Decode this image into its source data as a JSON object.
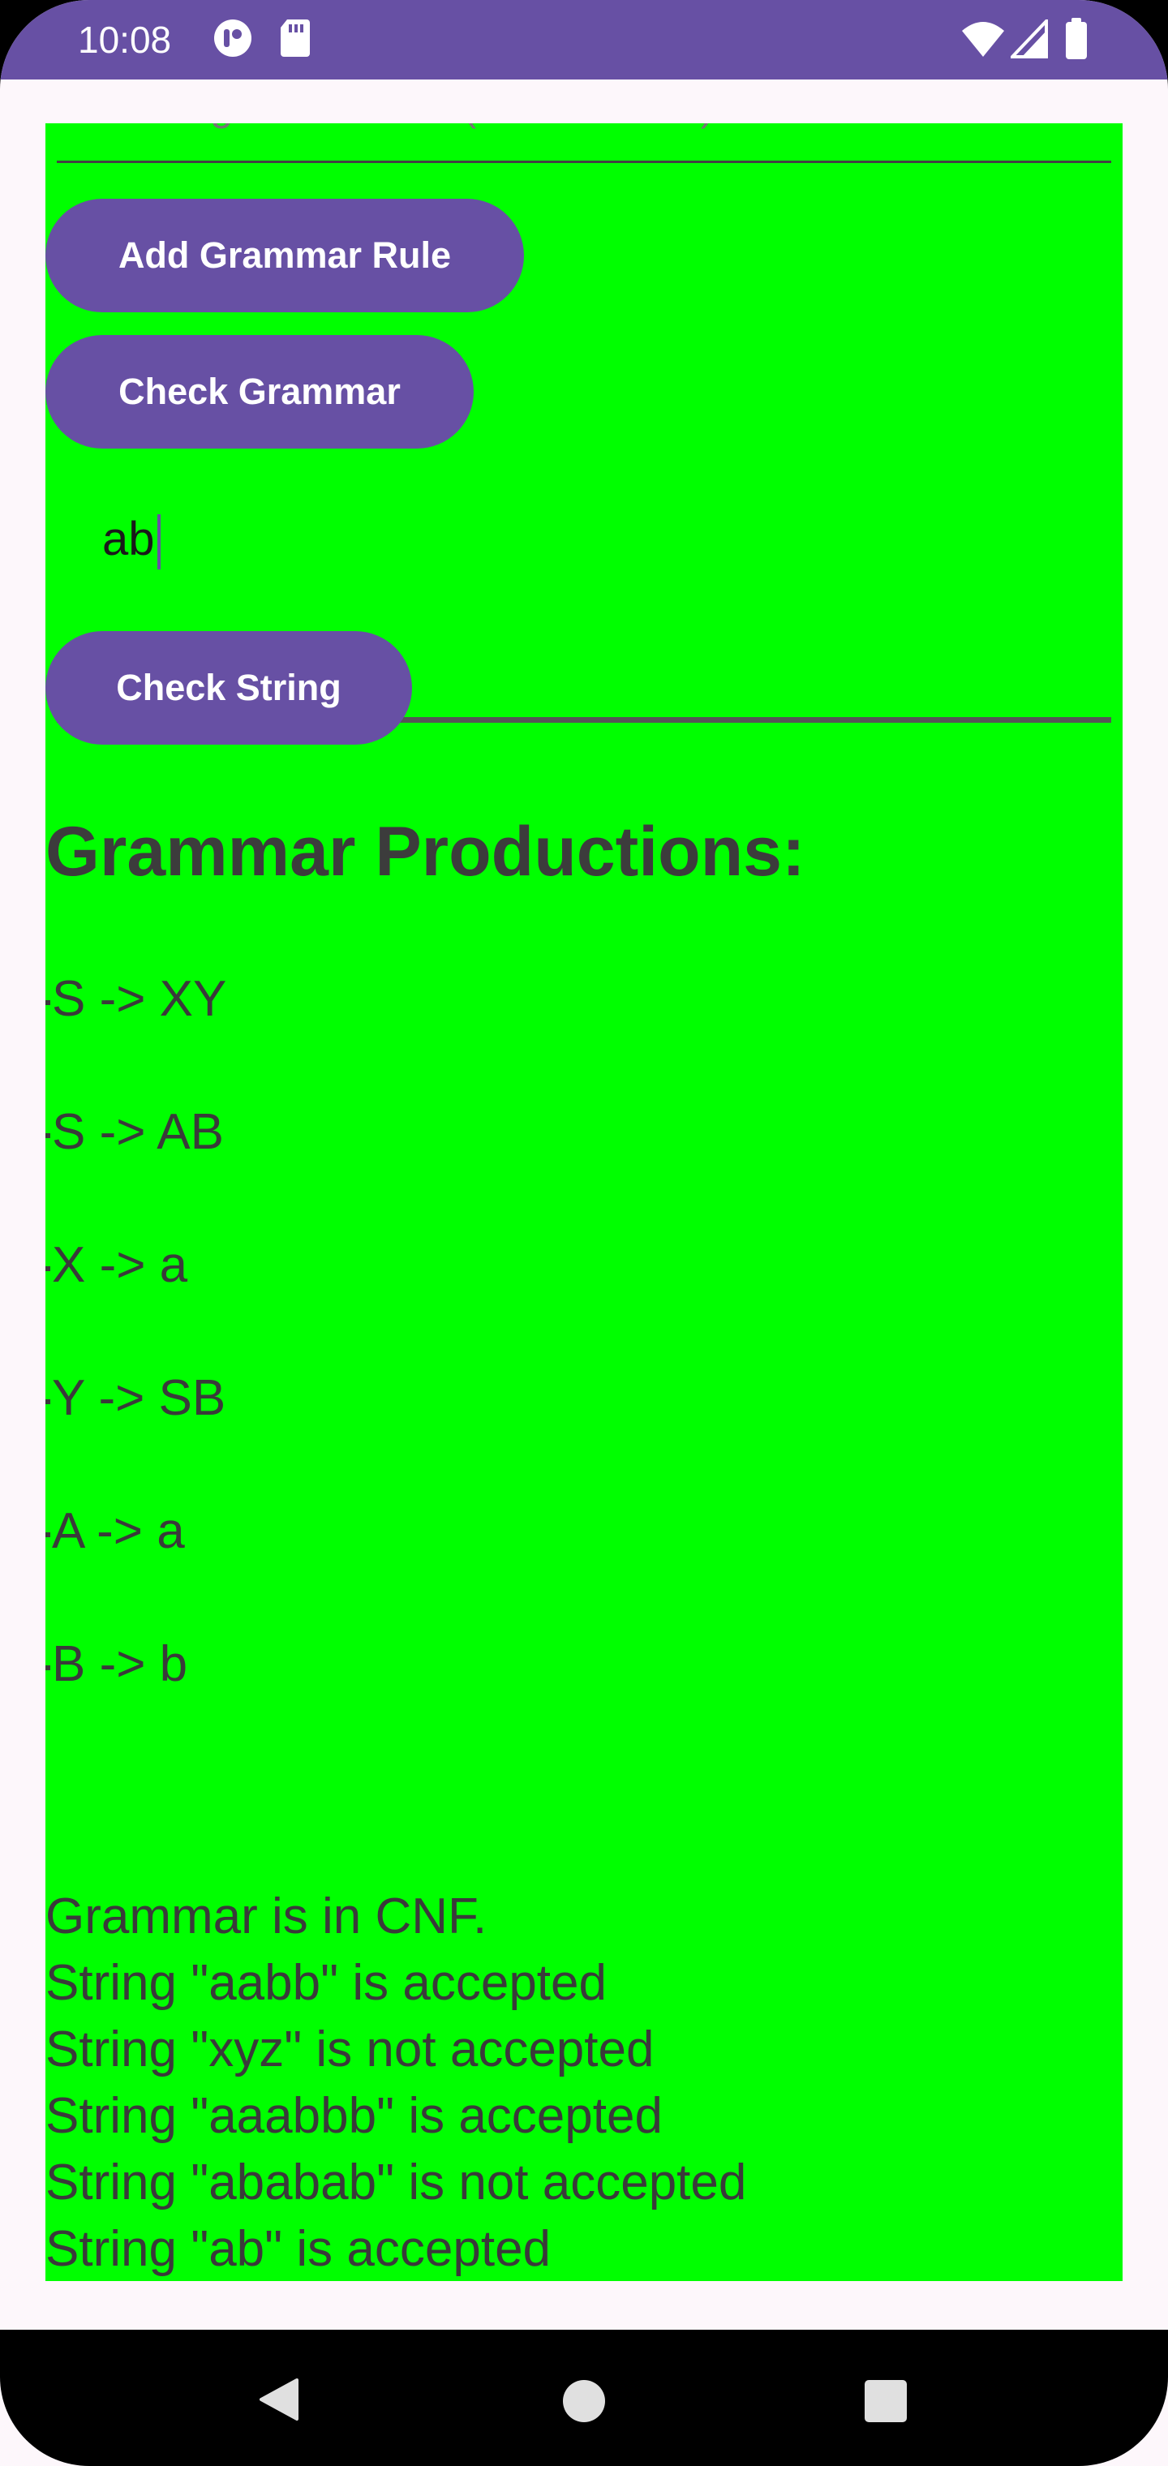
{
  "status_bar": {
    "time": "10:08",
    "left_icons": [
      "app-notification-icon",
      "sd-card-icon"
    ],
    "right_icons": [
      "wifi-icon",
      "cellular-signal-icon",
      "battery-icon"
    ],
    "color": "#6750a4"
  },
  "form": {
    "rule_input_placeholder": "Enter grammar rule (LHS -> RHS)",
    "rule_input_value": "",
    "add_rule_button": "Add Grammar Rule",
    "check_grammar_button": "Check Grammar",
    "string_input_value": "ab",
    "check_string_button": "Check String",
    "accent_color": "#6750a4"
  },
  "productions": {
    "title": "Grammar Productions:",
    "items": [
      "S -> XY",
      "S -> AB",
      "X -> a",
      "Y -> SB",
      "A -> a",
      "B -> b"
    ]
  },
  "results": [
    "Grammar is in CNF.",
    "String \"aabb\" is accepted",
    "String \"xyz\" is not accepted",
    "String \"aaabbb\" is accepted",
    "String \"ababab\" is not accepted",
    "String \"ab\" is accepted"
  ],
  "nav_bar": {
    "buttons": [
      "back-icon",
      "home-icon",
      "recents-icon"
    ]
  },
  "colors": {
    "content_background": "#00ff00",
    "app_background": "#fdf7fb"
  }
}
